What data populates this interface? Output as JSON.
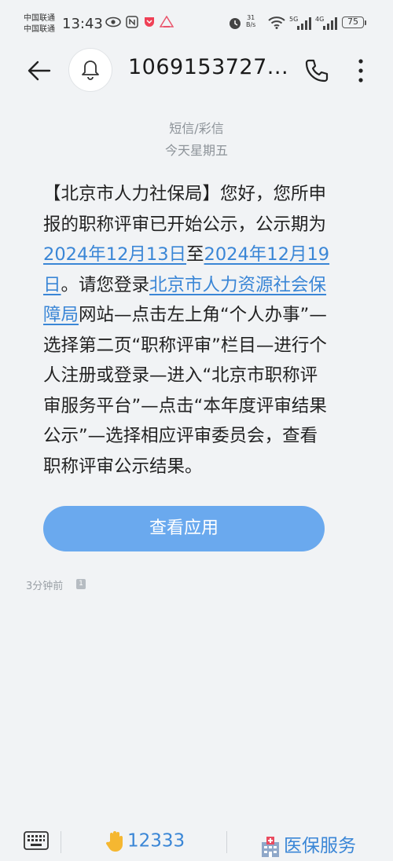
{
  "status_bar": {
    "carrier_1": "中国联通",
    "carrier_2": "中国联通",
    "time": "13:43",
    "net_speed_value": "31",
    "net_speed_unit": "B/s",
    "network_1": "5G",
    "network_2": "4G",
    "battery": "75"
  },
  "header": {
    "contact": "1069153727..."
  },
  "thread": {
    "type_label": "短信/彩信",
    "date_label": "今天星期五"
  },
  "message": {
    "p1": "【北京市人力社保局】您好，您所申报的职称评审已开始公示，公示期为",
    "link_start_date": "2024年12月13日",
    "p2": "至",
    "link_end_date": "2024年12月19日",
    "p3": "。请您登录",
    "link_site": "北京市人力资源社会保障局",
    "p4": "网站—点击左上角“个人办事”—选择第二页“职称评审”栏目—进行个人注册或登录—进入“北京市职称评审服务平台”—点击“本年度评审结果公示”—选择相应评审委员会，查看职称评审公示结果。",
    "action_label": "查看应用",
    "timestamp": "3分钟前",
    "sim_slot": "1"
  },
  "bottom_bar": {
    "shortcut_1": "12333",
    "shortcut_2": "医保服务"
  },
  "colors": {
    "accent": "#3a86d6",
    "button": "#6aa9ee",
    "background": "#f1f3f5"
  },
  "icons": [
    "back-arrow-icon",
    "bell-icon",
    "phone-icon",
    "more-icon",
    "keyboard-icon",
    "hand-icon",
    "hospital-icon",
    "eye-icon",
    "nfc-icon",
    "alarm-icon",
    "wifi-icon",
    "signal-icon"
  ]
}
